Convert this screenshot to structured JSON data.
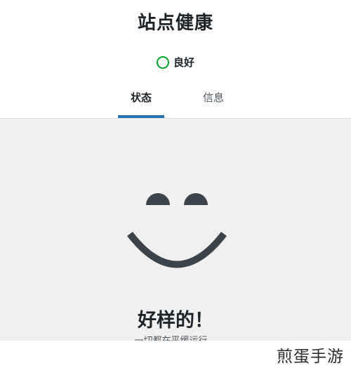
{
  "header": {
    "title": "站点健康",
    "status": {
      "label": "良好",
      "color": "#00a32a"
    }
  },
  "tabs": [
    {
      "label": "状态",
      "active": true
    },
    {
      "label": "信息",
      "active": false
    }
  ],
  "panel": {
    "smiley_icon": "smiley-face-icon",
    "heading": "好样的！",
    "message": "一切都在平缓运行。"
  },
  "watermark": "煎蛋手游",
  "colors": {
    "accent": "#2271b1",
    "good": "#00a32a",
    "panel_bg": "#f0f0f1",
    "icon": "#3c434a"
  }
}
